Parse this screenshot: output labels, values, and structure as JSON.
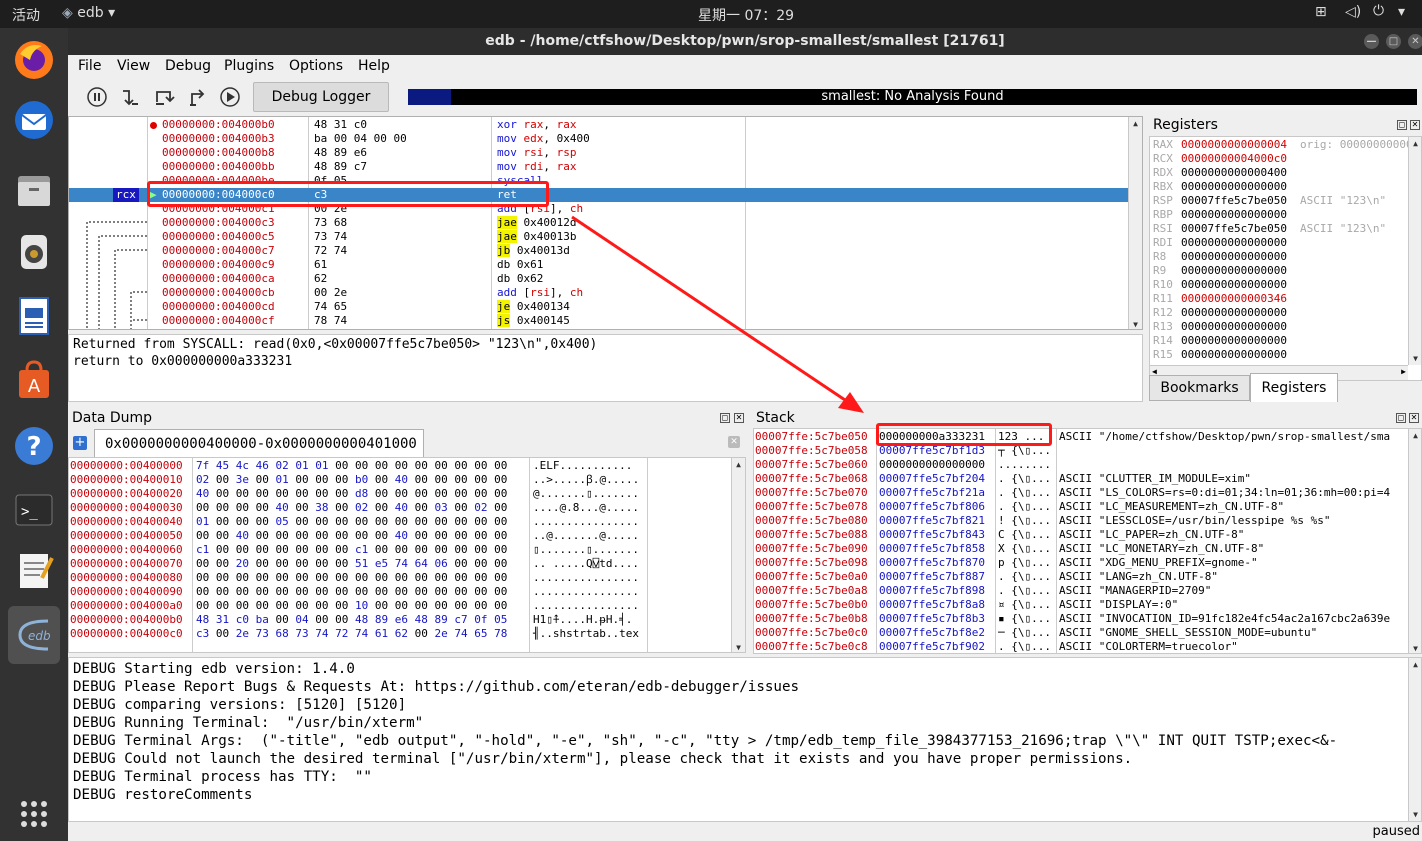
{
  "system": {
    "activities": "活动",
    "app_menu": "edb",
    "clock": "星期一 07：29"
  },
  "window": {
    "title": "edb - /home/ctfshow/Desktop/pwn/srop-smallest/smallest [21761]"
  },
  "menu": [
    "File",
    "View",
    "Debug",
    "Plugins",
    "Options",
    "Help"
  ],
  "toolbar": {
    "debug_logger": "Debug Logger",
    "analysis_status": "smallest: No Analysis Found"
  },
  "cpu": {
    "rows": [
      {
        "addr": "00000000:004000b0",
        "bytes": "48 31 c0",
        "asm": "xor rax, rax",
        "bp": true
      },
      {
        "addr": "00000000:004000b3",
        "bytes": "ba 00 04 00 00",
        "asm": "mov edx, 0x400"
      },
      {
        "addr": "00000000:004000b8",
        "bytes": "48 89 e6",
        "asm": "mov rsi, rsp"
      },
      {
        "addr": "00000000:004000bb",
        "bytes": "48 89 c7",
        "asm": "mov rdi, rax"
      },
      {
        "addr": "00000000:004000be",
        "bytes": "0f 05",
        "asm": "syscall"
      },
      {
        "addr": "00000000:004000c0",
        "bytes": "c3",
        "asm": "ret",
        "selected": true,
        "reg": "rcx"
      },
      {
        "addr": "00000000:004000c1",
        "bytes": "00 2e",
        "asm": "add [rsi], ch"
      },
      {
        "addr": "00000000:004000c3",
        "bytes": "73 68",
        "asm": "jae 0x40012d",
        "jmp": true
      },
      {
        "addr": "00000000:004000c5",
        "bytes": "73 74",
        "asm": "jae 0x40013b",
        "jmp": true
      },
      {
        "addr": "00000000:004000c7",
        "bytes": "72 74",
        "asm": "jb 0x40013d",
        "jmp": true
      },
      {
        "addr": "00000000:004000c9",
        "bytes": "61",
        "asm": "db 0x61"
      },
      {
        "addr": "00000000:004000ca",
        "bytes": "62",
        "asm": "db 0x62"
      },
      {
        "addr": "00000000:004000cb",
        "bytes": "00 2e",
        "asm": "add [rsi], ch"
      },
      {
        "addr": "00000000:004000cd",
        "bytes": "74 65",
        "asm": "je 0x400134",
        "jmp": true
      },
      {
        "addr": "00000000:004000cf",
        "bytes": "78 74",
        "asm": "js 0x400145",
        "jmp": true
      }
    ],
    "status_lines": [
      "Returned from SYSCALL: read(0x0,<0x00007ffe5c7be050> \"123\\n\",0x400)",
      "return to 0x000000000a333231"
    ]
  },
  "registers": {
    "title": "Registers",
    "rows": [
      {
        "name": "RAX",
        "value": "0000000000000004",
        "changed": true,
        "comment": "orig: 00000000000"
      },
      {
        "name": "RCX",
        "value": "00000000004000c0",
        "changed": true,
        "comment": ""
      },
      {
        "name": "RDX",
        "value": "0000000000000400",
        "changed": false,
        "comment": ""
      },
      {
        "name": "RBX",
        "value": "0000000000000000",
        "changed": false,
        "comment": ""
      },
      {
        "name": "RSP",
        "value": "00007ffe5c7be050",
        "changed": false,
        "comment": "ASCII \"123\\n\""
      },
      {
        "name": "RBP",
        "value": "0000000000000000",
        "changed": false,
        "comment": ""
      },
      {
        "name": "RSI",
        "value": "00007ffe5c7be050",
        "changed": false,
        "comment": "ASCII \"123\\n\""
      },
      {
        "name": "RDI",
        "value": "0000000000000000",
        "changed": false,
        "comment": ""
      },
      {
        "name": "R8",
        "value": "0000000000000000",
        "changed": false,
        "comment": ""
      },
      {
        "name": "R9",
        "value": "0000000000000000",
        "changed": false,
        "comment": ""
      },
      {
        "name": "R10",
        "value": "0000000000000000",
        "changed": false,
        "comment": ""
      },
      {
        "name": "R11",
        "value": "0000000000000346",
        "changed": true,
        "comment": ""
      },
      {
        "name": "R12",
        "value": "0000000000000000",
        "changed": false,
        "comment": ""
      },
      {
        "name": "R13",
        "value": "0000000000000000",
        "changed": false,
        "comment": ""
      },
      {
        "name": "R14",
        "value": "0000000000000000",
        "changed": false,
        "comment": ""
      },
      {
        "name": "R15",
        "value": "0000000000000000",
        "changed": false,
        "comment": ""
      }
    ],
    "tabs": [
      "Bookmarks",
      "Registers"
    ]
  },
  "data_dump": {
    "title": "Data Dump",
    "tab": "0x0000000000400000-0x0000000000401000",
    "rows": [
      {
        "addr": "00000000:00400000",
        "hex": "7f 45 4c 46 02 01 01 00 00 00 00 00 00 00 00 00",
        "ascii": ".ELF..........."
      },
      {
        "addr": "00000000:00400010",
        "hex": "02 00 3e 00 01 00 00 00 b0 00 40 00 00 00 00 00",
        "ascii": "..>.....ꞵ.@....."
      },
      {
        "addr": "00000000:00400020",
        "hex": "40 00 00 00 00 00 00 00 d8 00 00 00 00 00 00 00",
        "ascii": "@.......▯......."
      },
      {
        "addr": "00000000:00400030",
        "hex": "00 00 00 00 40 00 38 00 02 00 40 00 03 00 02 00",
        "ascii": "....@.8...@....."
      },
      {
        "addr": "00000000:00400040",
        "hex": "01 00 00 00 05 00 00 00 00 00 00 00 00 00 00 00",
        "ascii": "................"
      },
      {
        "addr": "00000000:00400050",
        "hex": "00 00 40 00 00 00 00 00 00 00 40 00 00 00 00 00",
        "ascii": "..@.......@....."
      },
      {
        "addr": "00000000:00400060",
        "hex": "c1 00 00 00 00 00 00 00 c1 00 00 00 00 00 00 00",
        "ascii": "▯.......▯......."
      },
      {
        "addr": "00000000:00400070",
        "hex": "00 00 20 00 00 00 00 00 51 e5 74 64 06 00 00 00",
        "ascii": ".. .....Q⍌td...."
      },
      {
        "addr": "00000000:00400080",
        "hex": "00 00 00 00 00 00 00 00 00 00 00 00 00 00 00 00",
        "ascii": "................"
      },
      {
        "addr": "00000000:00400090",
        "hex": "00 00 00 00 00 00 00 00 00 00 00 00 00 00 00 00",
        "ascii": "................"
      },
      {
        "addr": "00000000:004000a0",
        "hex": "00 00 00 00 00 00 00 00 10 00 00 00 00 00 00 00",
        "ascii": "................"
      },
      {
        "addr": "00000000:004000b0",
        "hex": "48 31 c0 ba 00 04 00 00 48 89 e6 48 89 c7 0f 05",
        "ascii": "H1▯⍏....H.ᵽH.╡."
      },
      {
        "addr": "00000000:004000c0",
        "hex": "c3 00 2e 73 68 73 74 72 74 61 62 00 2e 74 65 78",
        "ascii": "╢..shstrtab..tex"
      }
    ]
  },
  "stack": {
    "title": "Stack",
    "rows": [
      {
        "addr": "00007ffe:5c7be050",
        "value": "000000000a333231",
        "chars": "123 ...",
        "comment": "ASCII \"/home/ctfshow/Desktop/pwn/srop-smallest/sma"
      },
      {
        "addr": "00007ffe:5c7be058",
        "value": "00007ffe5c7bf1d3",
        "chars": "┬ {\\▯...",
        "comment": ""
      },
      {
        "addr": "00007ffe:5c7be060",
        "value": "0000000000000000",
        "chars": "........",
        "comment": ""
      },
      {
        "addr": "00007ffe:5c7be068",
        "value": "00007ffe5c7bf204",
        "chars": ". {\\▯...",
        "comment": "ASCII \"CLUTTER_IM_MODULE=xim\""
      },
      {
        "addr": "00007ffe:5c7be070",
        "value": "00007ffe5c7bf21a",
        "chars": ". {\\▯...",
        "comment": "ASCII \"LS_COLORS=rs=0:di=01;34:ln=01;36:mh=00:pi=4"
      },
      {
        "addr": "00007ffe:5c7be078",
        "value": "00007ffe5c7bf806",
        "chars": ". {\\▯...",
        "comment": "ASCII \"LC_MEASUREMENT=zh_CN.UTF-8\""
      },
      {
        "addr": "00007ffe:5c7be080",
        "value": "00007ffe5c7bf821",
        "chars": "! {\\▯...",
        "comment": "ASCII \"LESSCLOSE=/usr/bin/lesspipe %s %s\""
      },
      {
        "addr": "00007ffe:5c7be088",
        "value": "00007ffe5c7bf843",
        "chars": "C {\\▯...",
        "comment": "ASCII \"LC_PAPER=zh_CN.UTF-8\""
      },
      {
        "addr": "00007ffe:5c7be090",
        "value": "00007ffe5c7bf858",
        "chars": "X {\\▯...",
        "comment": "ASCII \"LC_MONETARY=zh_CN.UTF-8\""
      },
      {
        "addr": "00007ffe:5c7be098",
        "value": "00007ffe5c7bf870",
        "chars": "p {\\▯...",
        "comment": "ASCII \"XDG_MENU_PREFIX=gnome-\""
      },
      {
        "addr": "00007ffe:5c7be0a0",
        "value": "00007ffe5c7bf887",
        "chars": ". {\\▯...",
        "comment": "ASCII \"LANG=zh_CN.UTF-8\""
      },
      {
        "addr": "00007ffe:5c7be0a8",
        "value": "00007ffe5c7bf898",
        "chars": ". {\\▯...",
        "comment": "ASCII \"MANAGERPID=2709\""
      },
      {
        "addr": "00007ffe:5c7be0b0",
        "value": "00007ffe5c7bf8a8",
        "chars": "¤ {\\▯...",
        "comment": "ASCII \"DISPLAY=:0\""
      },
      {
        "addr": "00007ffe:5c7be0b8",
        "value": "00007ffe5c7bf8b3",
        "chars": "▪ {\\▯...",
        "comment": "ASCII \"INVOCATION_ID=91fc182e4fc54ac2a167cbc2a639e"
      },
      {
        "addr": "00007ffe:5c7be0c0",
        "value": "00007ffe5c7bf8e2",
        "chars": "─ {\\▯...",
        "comment": "ASCII \"GNOME_SHELL_SESSION_MODE=ubuntu\""
      },
      {
        "addr": "00007ffe:5c7be0c8",
        "value": "00007ffe5c7bf902",
        "chars": ". {\\▯...",
        "comment": "ASCII \"COLORTERM=truecolor\""
      }
    ]
  },
  "log": {
    "lines": [
      "DEBUG Starting edb version: 1.4.0",
      "DEBUG Please Report Bugs & Requests At: https://github.com/eteran/edb-debugger/issues",
      "DEBUG comparing versions: [5120] [5120]",
      "DEBUG Running Terminal:  \"/usr/bin/xterm\"",
      "DEBUG Terminal Args:  (\"-title\", \"edb output\", \"-hold\", \"-e\", \"sh\", \"-c\", \"tty > /tmp/edb_temp_file_3984377153_21696;trap \\\"\\\" INT QUIT TSTP;exec<&-",
      "DEBUG Could not launch the desired terminal [\"/usr/bin/xterm\"], please check that it exists and you have proper permissions.",
      "DEBUG Terminal process has TTY:  \"\"",
      "DEBUG restoreComments"
    ]
  },
  "statusbar": {
    "state": "paused"
  },
  "colors": {
    "accent_selection": "#3a84c8",
    "annotation_red": "#ff1a1a",
    "changed_register": "#d40000"
  }
}
